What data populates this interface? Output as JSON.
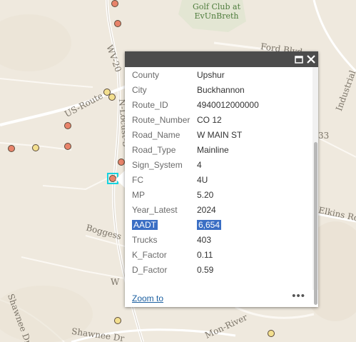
{
  "map": {
    "labels": {
      "golf_line1": "Golf Club at",
      "golf_line2": "EvUnBreth",
      "us_route": "US-Route",
      "wv_route": "WV-20",
      "ford_blvd": "Ford Blvd",
      "industrial": "Industrial",
      "elkins_rd": "Elkins Rd",
      "boggess": "Boggess",
      "w_partial": "W",
      "locust": "N-Locust-S",
      "shawnee_dr": "Shawnee Dr",
      "shawnee_dr2": "Shawnee Dr",
      "river": "Mon-River",
      "num_33": "33"
    }
  },
  "popup": {
    "attributes": [
      {
        "key": "County",
        "value": "Upshur"
      },
      {
        "key": "City",
        "value": "Buckhannon"
      },
      {
        "key": "Route_ID",
        "value": "4940012000000"
      },
      {
        "key": "Route_Number",
        "value": "CO 12"
      },
      {
        "key": "Road_Name",
        "value": "W MAIN ST"
      },
      {
        "key": "Road_Type",
        "value": "Mainline"
      },
      {
        "key": "Sign_System",
        "value": "4"
      },
      {
        "key": "FC",
        "value": "4U"
      },
      {
        "key": "MP",
        "value": "5.20"
      },
      {
        "key": "Year_Latest",
        "value": "2024"
      },
      {
        "key": "AADT",
        "value": "6,654"
      },
      {
        "key": "Trucks",
        "value": "403"
      },
      {
        "key": "K_Factor",
        "value": "0.11"
      },
      {
        "key": "D_Factor",
        "value": "0.59"
      }
    ],
    "zoom_label": "Zoom to",
    "more_label": "•••"
  }
}
